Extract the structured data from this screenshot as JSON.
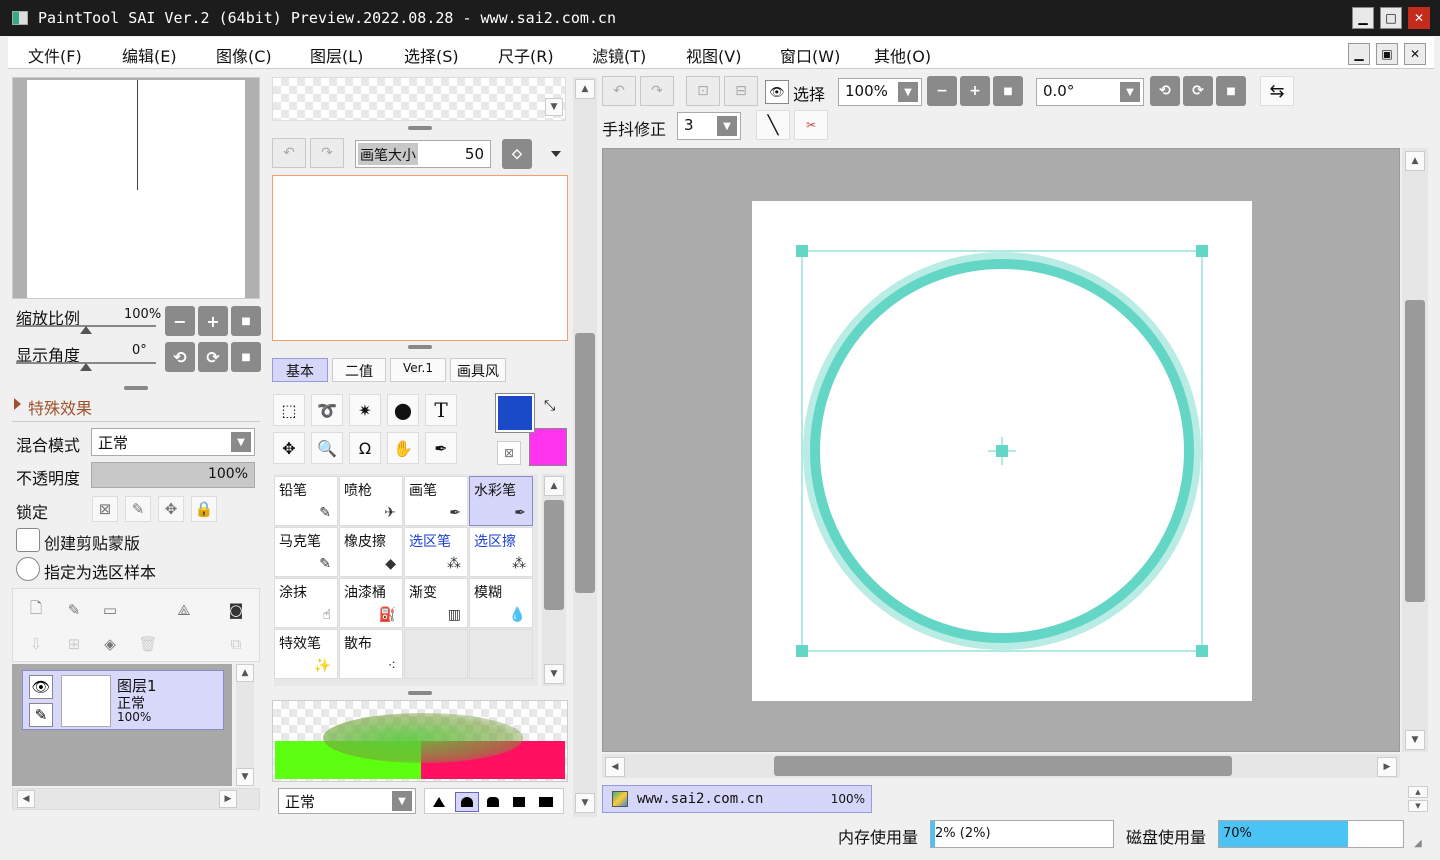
{
  "window": {
    "title": "PaintTool SAI Ver.2 (64bit) Preview.2022.08.28 - www.sai2.com.cn",
    "min_btn": "▁",
    "max_btn": "□",
    "close_btn": "✕"
  },
  "menubar": {
    "items": [
      "文件(F)",
      "编辑(E)",
      "图像(C)",
      "图层(L)",
      "选择(S)",
      "尺子(R)",
      "滤镜(T)",
      "视图(V)",
      "窗口(W)",
      "其他(O)"
    ],
    "doc_min": "▁",
    "doc_restore": "▣",
    "doc_close": "✕"
  },
  "navigator": {
    "zoom_label": "缩放比例",
    "zoom_value": "100%",
    "angle_label": "显示角度",
    "angle_value": "0°",
    "minus": "−",
    "plus": "+",
    "reset": "■",
    "rot_left": "⟲",
    "rot_right": "⟳"
  },
  "effects": {
    "label": "特殊效果"
  },
  "layer_props": {
    "blend_label": "混合模式",
    "blend_value": "正常",
    "opacity_label": "不透明度",
    "opacity_value": "100%",
    "opacity_fraction": 1.0,
    "lock_label": "锁定",
    "clip_label": "创建剪贴蒙版",
    "sample_label": "指定为选区样本"
  },
  "layers": [
    {
      "name": "图层1",
      "mode": "正常",
      "opacity": "100%"
    }
  ],
  "brush": {
    "size_label": "画笔大小",
    "size_value": "50"
  },
  "tool_tabs": [
    "基本",
    "二值",
    "Ver.1",
    "画具风"
  ],
  "colors": {
    "primary": "#1a4ac8",
    "secondary": "#ff33ee",
    "accent": "#63d6c5",
    "accent_light": "#b8ece4",
    "active_tab": "#d6d6fa"
  },
  "tools": [
    {
      "name": "铅笔",
      "icon": "✎",
      "style": "normal"
    },
    {
      "name": "喷枪",
      "icon": "✈",
      "style": "normal"
    },
    {
      "name": "画笔",
      "icon": "✒",
      "style": "normal"
    },
    {
      "name": "水彩笔",
      "icon": "✒",
      "style": "selected"
    },
    {
      "name": "马克笔",
      "icon": "✎",
      "style": "normal"
    },
    {
      "name": "橡皮擦",
      "icon": "◆",
      "style": "normal"
    },
    {
      "name": "选区笔",
      "icon": "⁂",
      "style": "blue"
    },
    {
      "name": "选区擦",
      "icon": "⁂",
      "style": "blue"
    },
    {
      "name": "涂抹",
      "icon": "☝",
      "style": "normal"
    },
    {
      "name": "油漆桶",
      "icon": "⛽",
      "style": "normal"
    },
    {
      "name": "渐变",
      "icon": "▥",
      "style": "normal"
    },
    {
      "name": "模糊",
      "icon": "💧",
      "style": "normal"
    },
    {
      "name": "特效笔",
      "icon": "✨",
      "style": "normal"
    },
    {
      "name": "散布",
      "icon": "⁖",
      "style": "normal"
    }
  ],
  "brush_mode": {
    "value": "正常"
  },
  "toolbar": {
    "select_label": "选择",
    "zoom_value": "100%",
    "angle_value": "0.0°",
    "stabilizer_label": "手抖修正",
    "stabilizer_value": "3"
  },
  "doc_tab": {
    "name": "www.sai2.com.cn",
    "zoom": "100%"
  },
  "status": {
    "mem_label": "内存使用量",
    "mem_value": "2% (2%)",
    "mem_fraction": 0.02,
    "disk_label": "磁盘使用量",
    "disk_value": "70%",
    "disk_fraction": 0.7
  }
}
